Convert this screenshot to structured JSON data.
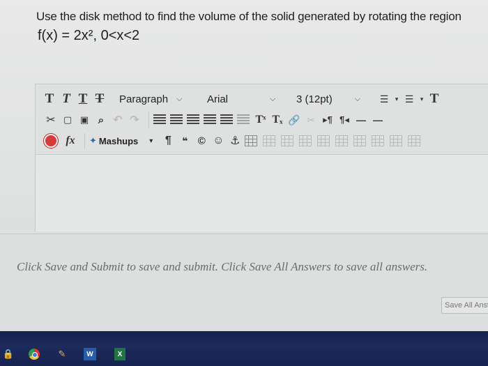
{
  "question": {
    "instruction": "Use the disk method to find the volume of the solid generated by rotating the region",
    "function": "f(x) = 2x², 0<x<2"
  },
  "editor": {
    "format_buttons": [
      "T",
      "T",
      "T",
      "T"
    ],
    "paragraph": "Paragraph",
    "font": "Arial",
    "size": "3 (12pt)",
    "mashups": "Mashups",
    "fx": "fx",
    "pilcrow": "¶",
    "quote": "❝",
    "copyright": "©",
    "superscript": "Tˣ",
    "subscript": "Tₓ"
  },
  "footer": {
    "save_note": "Click Save and Submit to save and submit. Click Save All Answers to save all answers.",
    "save_all_label": "Save All Answers"
  },
  "taskbar": {
    "word_label": "W",
    "excel_label": "X"
  }
}
